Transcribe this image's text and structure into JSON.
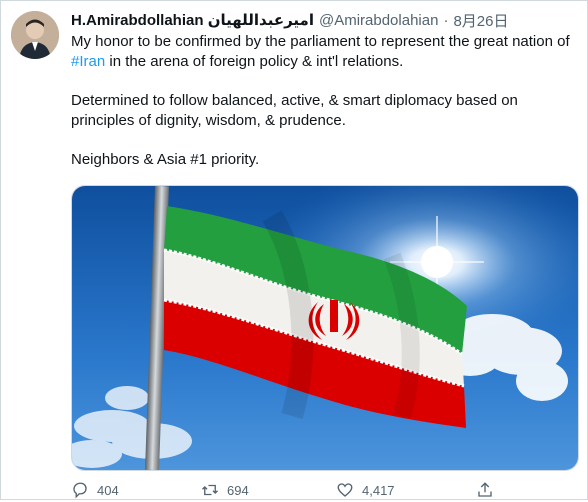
{
  "tweet": {
    "display_name": "H.Amirabdollahian امیرعبداللهیان",
    "handle": "@Amirabdolahian",
    "separator": "·",
    "date": "8月26日",
    "line1_pre": "My honor to be confirmed by the parliament to represent the great nation of ",
    "hashtag": "#Iran",
    "line1_post": " in the arena of foreign policy & int'l relations.",
    "para2": "Determined to follow balanced, active, & smart diplomacy based on principles of dignity, wisdom, & prudence.",
    "para3": "Neighbors & Asia #1 priority."
  },
  "actions": {
    "reply_count": "404",
    "retweet_count": "694",
    "like_count": "4,417"
  },
  "colors": {
    "link": "#1d9bf0",
    "muted": "#536471",
    "flag_green": "#239f40",
    "flag_red": "#da0000",
    "sky": "#1f67b8"
  },
  "icons": [
    "avatar",
    "reply-icon",
    "retweet-icon",
    "like-icon",
    "share-icon",
    "iran-emblem-icon"
  ]
}
